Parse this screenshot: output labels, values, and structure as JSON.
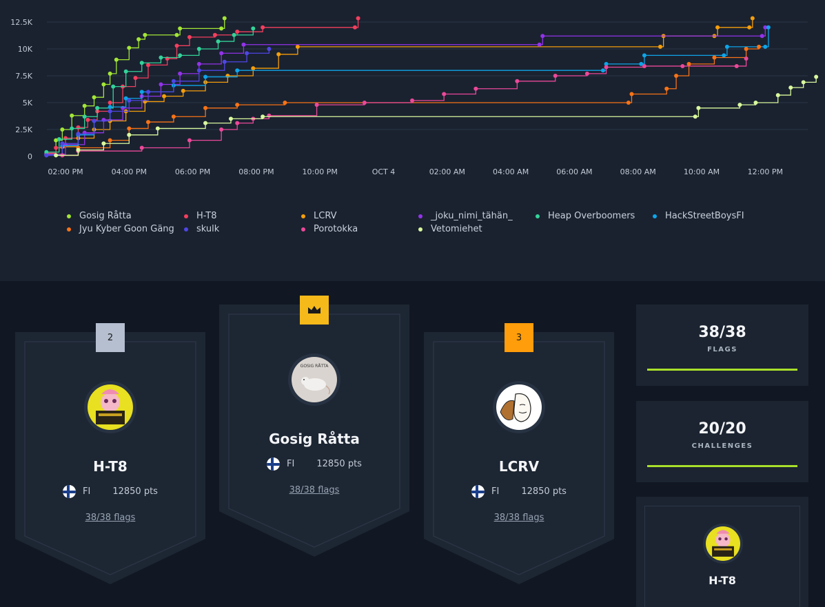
{
  "chart_data": {
    "type": "line",
    "x_ticks": [
      "02:00 PM",
      "04:00 PM",
      "06:00 PM",
      "08:00 PM",
      "10:00 PM",
      "OCT 4",
      "02:00 AM",
      "04:00 AM",
      "06:00 AM",
      "08:00 AM",
      "10:00 AM",
      "12:00 PM"
    ],
    "y_ticks": [
      "0",
      "2.5K",
      "5K",
      "7.5K",
      "10K",
      "12.5K"
    ],
    "ylim": [
      0,
      12500
    ],
    "x_unit": "hours since 01:00 PM Oct 3",
    "series": [
      {
        "name": "Gosig Råtta",
        "color": "#a3e635",
        "points": [
          [
            0,
            200
          ],
          [
            0.3,
            1500
          ],
          [
            0.5,
            2500
          ],
          [
            0.8,
            3800
          ],
          [
            1.2,
            4700
          ],
          [
            1.5,
            5500
          ],
          [
            1.8,
            6700
          ],
          [
            2.0,
            7700
          ],
          [
            2.2,
            9000
          ],
          [
            2.6,
            10100
          ],
          [
            2.9,
            10900
          ],
          [
            3.1,
            11300
          ],
          [
            4.1,
            11300
          ],
          [
            4.2,
            11900
          ],
          [
            5.5,
            11900
          ],
          [
            5.6,
            12850
          ]
        ]
      },
      {
        "name": "H-T8",
        "color": "#f43f5e",
        "points": [
          [
            0,
            300
          ],
          [
            0.3,
            800
          ],
          [
            0.6,
            1700
          ],
          [
            1.0,
            2700
          ],
          [
            1.3,
            3400
          ],
          [
            1.6,
            4200
          ],
          [
            2.0,
            5000
          ],
          [
            2.4,
            6500
          ],
          [
            2.8,
            7300
          ],
          [
            3.2,
            8500
          ],
          [
            3.8,
            9100
          ],
          [
            4.1,
            10300
          ],
          [
            4.5,
            11100
          ],
          [
            5.3,
            11300
          ],
          [
            6.0,
            11600
          ],
          [
            6.8,
            12000
          ],
          [
            9.7,
            12000
          ],
          [
            9.8,
            12850
          ]
        ]
      },
      {
        "name": "LCRV",
        "color": "#f59e0b",
        "points": [
          [
            0,
            200
          ],
          [
            0.5,
            900
          ],
          [
            1.0,
            1700
          ],
          [
            1.5,
            2500
          ],
          [
            2.0,
            3300
          ],
          [
            2.5,
            4200
          ],
          [
            3.1,
            5100
          ],
          [
            3.7,
            5600
          ],
          [
            4.3,
            6100
          ],
          [
            5.0,
            6900
          ],
          [
            5.7,
            7500
          ],
          [
            6.5,
            8200
          ],
          [
            7.3,
            9500
          ],
          [
            7.9,
            10200
          ],
          [
            19.3,
            10200
          ],
          [
            19.4,
            11200
          ],
          [
            21.0,
            11200
          ],
          [
            21.1,
            12000
          ],
          [
            22.1,
            12000
          ],
          [
            22.2,
            12850
          ]
        ]
      },
      {
        "name": "_joku_nimi_tähän_",
        "color": "#9333ea",
        "points": [
          [
            0,
            200
          ],
          [
            0.6,
            1100
          ],
          [
            1.2,
            2200
          ],
          [
            1.8,
            3400
          ],
          [
            2.4,
            4500
          ],
          [
            3.0,
            5600
          ],
          [
            3.6,
            6700
          ],
          [
            4.2,
            7700
          ],
          [
            4.8,
            8600
          ],
          [
            5.5,
            9600
          ],
          [
            6.2,
            10400
          ],
          [
            15.5,
            10400
          ],
          [
            15.6,
            11200
          ],
          [
            22.5,
            11200
          ],
          [
            22.6,
            12000
          ]
        ]
      },
      {
        "name": "Heap Overboomers",
        "color": "#34d399",
        "points": [
          [
            0,
            400
          ],
          [
            0.4,
            1600
          ],
          [
            0.8,
            2600
          ],
          [
            1.2,
            3700
          ],
          [
            1.6,
            4500
          ],
          [
            2.1,
            6500
          ],
          [
            2.5,
            7900
          ],
          [
            3.0,
            8700
          ],
          [
            3.6,
            9200
          ],
          [
            4.2,
            9400
          ],
          [
            4.8,
            10000
          ],
          [
            5.4,
            10700
          ],
          [
            5.9,
            11300
          ],
          [
            6.5,
            11900
          ]
        ]
      },
      {
        "name": "HackStreetBoysFI",
        "color": "#0ea5e9",
        "points": [
          [
            0,
            100
          ],
          [
            0.5,
            1000
          ],
          [
            1.0,
            2000
          ],
          [
            1.5,
            3300
          ],
          [
            2.0,
            4600
          ],
          [
            2.5,
            5400
          ],
          [
            3.0,
            6000
          ],
          [
            4.0,
            6600
          ],
          [
            5.0,
            7400
          ],
          [
            6.0,
            8000
          ],
          [
            17.5,
            8000
          ],
          [
            17.6,
            8600
          ],
          [
            18.7,
            8600
          ],
          [
            18.8,
            9400
          ],
          [
            21.3,
            9400
          ],
          [
            21.4,
            10200
          ],
          [
            22.6,
            10200
          ],
          [
            22.7,
            12000
          ]
        ]
      },
      {
        "name": "Jyu Kyber Goon Gäng",
        "color": "#f97316",
        "points": [
          [
            0.5,
            100
          ],
          [
            1.0,
            800
          ],
          [
            2.0,
            1500
          ],
          [
            2.6,
            2600
          ],
          [
            3.2,
            3200
          ],
          [
            4.0,
            3700
          ],
          [
            5.0,
            4500
          ],
          [
            6.0,
            4800
          ],
          [
            7.5,
            5000
          ],
          [
            18.3,
            5000
          ],
          [
            18.4,
            5800
          ],
          [
            19.5,
            6300
          ],
          [
            19.8,
            7500
          ],
          [
            20.2,
            8600
          ],
          [
            21.0,
            9200
          ],
          [
            22.0,
            10000
          ],
          [
            22.4,
            10200
          ]
        ]
      },
      {
        "name": "skulk",
        "color": "#4f46e5",
        "points": [
          [
            0,
            100
          ],
          [
            0.5,
            1200
          ],
          [
            1.0,
            2100
          ],
          [
            1.5,
            3300
          ],
          [
            2.0,
            4200
          ],
          [
            2.6,
            5200
          ],
          [
            3.2,
            6000
          ],
          [
            4.0,
            7000
          ],
          [
            4.8,
            8000
          ],
          [
            5.6,
            8800
          ],
          [
            6.3,
            9600
          ],
          [
            7.0,
            10000
          ]
        ]
      },
      {
        "name": "Porotokka",
        "color": "#ec4899",
        "points": [
          [
            0.5,
            100
          ],
          [
            1.0,
            500
          ],
          [
            3.0,
            800
          ],
          [
            4.5,
            1500
          ],
          [
            5.5,
            2500
          ],
          [
            6.0,
            3100
          ],
          [
            6.5,
            3500
          ],
          [
            7.0,
            3800
          ],
          [
            8.5,
            4800
          ],
          [
            10.0,
            5000
          ],
          [
            11.5,
            5200
          ],
          [
            12.5,
            5800
          ],
          [
            13.5,
            6300
          ],
          [
            14.8,
            7000
          ],
          [
            16.0,
            7500
          ],
          [
            17.0,
            7700
          ],
          [
            17.6,
            8300
          ],
          [
            18.8,
            8400
          ],
          [
            20.0,
            8400
          ],
          [
            21.7,
            8400
          ],
          [
            22.0,
            9100
          ]
        ]
      },
      {
        "name": "Vetomiehet",
        "color": "#d9f99d",
        "points": [
          [
            0.3,
            100
          ],
          [
            1.0,
            600
          ],
          [
            1.8,
            1200
          ],
          [
            2.6,
            2000
          ],
          [
            3.5,
            2600
          ],
          [
            5.0,
            3100
          ],
          [
            5.8,
            3500
          ],
          [
            6.8,
            3700
          ],
          [
            20.4,
            3700
          ],
          [
            20.5,
            4500
          ],
          [
            21.8,
            4800
          ],
          [
            22.3,
            5000
          ],
          [
            23.0,
            5700
          ],
          [
            23.4,
            6400
          ],
          [
            23.8,
            6900
          ],
          [
            24.2,
            7400
          ]
        ]
      }
    ]
  },
  "podium": {
    "second": {
      "rank": "2",
      "name": "H-T8",
      "country": "FI",
      "points": "12850 pts",
      "flags": "38/38 flags"
    },
    "first": {
      "name": "Gosig Råtta",
      "avatar_text": "GOSIG RÅTTA",
      "country": "FI",
      "points": "12850 pts",
      "flags": "38/38 flags"
    },
    "third": {
      "rank": "3",
      "name": "LCRV",
      "country": "FI",
      "points": "12850 pts",
      "flags": "38/38 flags"
    }
  },
  "stats": {
    "flags": {
      "value": "38/38",
      "label": "FLAGS",
      "progress": 1.0
    },
    "challenges": {
      "value": "20/20",
      "label": "CHALLENGES",
      "progress": 1.0
    }
  },
  "first_blood_team": {
    "name": "H-T8"
  },
  "colors": {
    "accent_bar": "#a9e02a",
    "gold": "#f5b91a",
    "orange": "#ff9d0a",
    "silver": "#b5bfd0"
  }
}
